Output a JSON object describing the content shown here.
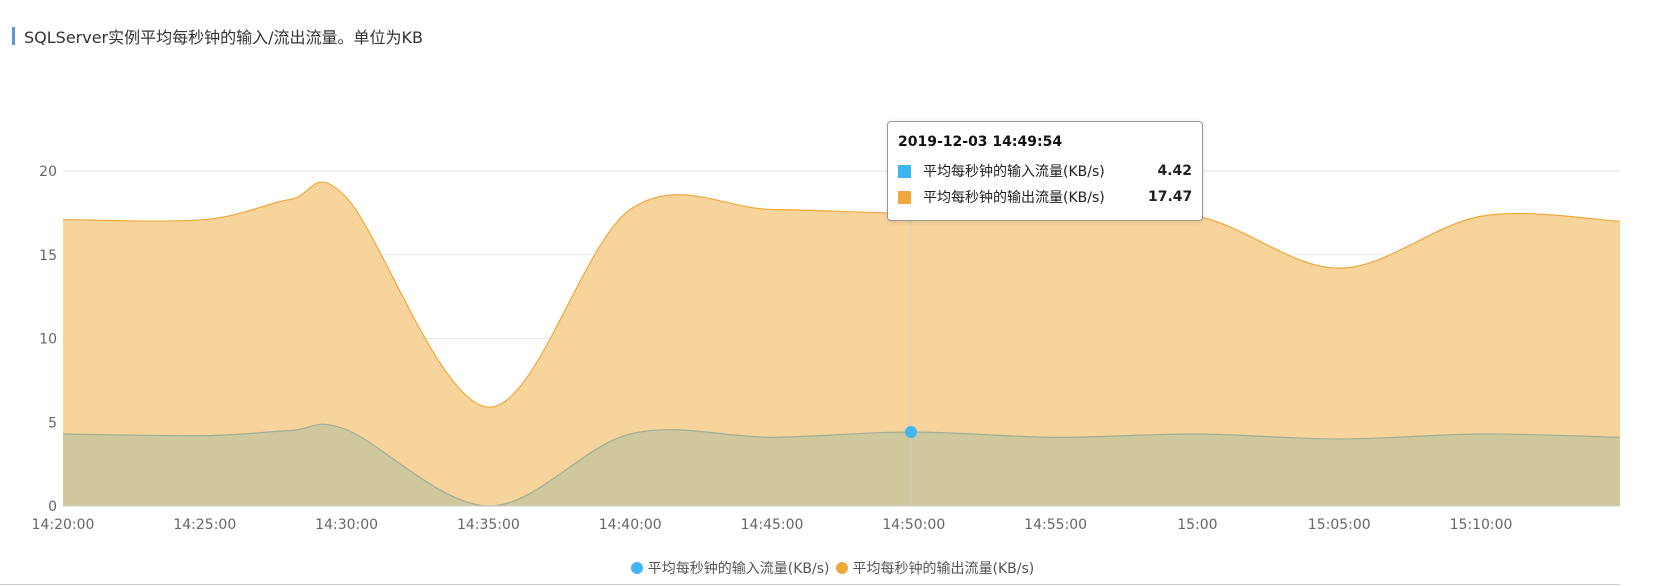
{
  "header": {
    "title": "SQLServer实例平均每秒钟的输入/流出流量。单位为KB"
  },
  "chart_data": {
    "type": "area",
    "title": "SQLServer实例平均每秒钟的输入/流出流量。单位为KB",
    "xlabel": "",
    "ylabel": "",
    "ylim": [
      0,
      20
    ],
    "yticks": [
      "0",
      "5",
      "10",
      "15",
      "20"
    ],
    "xlim": [
      "14:20:00",
      "15:14:54"
    ],
    "xticks": [
      "14:20:00",
      "14:25:00",
      "14:30:00",
      "14:35:00",
      "14:40:00",
      "14:45:00",
      "14:50:00",
      "14:55:00",
      "15:00",
      "15:05:00",
      "15:10:00"
    ],
    "grid": true,
    "legend_position": "bottom",
    "x": [
      "14:20:00",
      "14:25:00",
      "14:28:00",
      "14:30:00",
      "14:35:00",
      "14:40:00",
      "14:45:00",
      "14:49:54",
      "14:55:00",
      "15:00",
      "15:05:00",
      "15:10:00",
      "15:14:54"
    ],
    "series": [
      {
        "name": "平均每秒钟的输入流量(KB/s)",
        "color": "#3fb6f4",
        "fill": "#c8c69e",
        "values": [
          4.3,
          4.2,
          4.5,
          4.55,
          0.0,
          4.3,
          4.1,
          4.42,
          4.1,
          4.3,
          4.0,
          4.3,
          4.1
        ]
      },
      {
        "name": "平均每秒钟的输出流量(KB/s)",
        "color": "#f0a83c",
        "fill": "#f7d49b",
        "values": [
          17.1,
          17.1,
          18.3,
          18.4,
          5.9,
          17.7,
          17.7,
          17.47,
          17.5,
          17.3,
          14.2,
          17.3,
          17.0
        ]
      }
    ],
    "tooltip": {
      "time": "2019-12-03 14:49:54",
      "rows": [
        {
          "name": "平均每秒钟的输入流量(KB/s)",
          "value": "4.42",
          "color": "#3fb6f4"
        },
        {
          "name": "平均每秒钟的输出流量(KB/s)",
          "value": "17.47",
          "color": "#f0a83c"
        }
      ]
    }
  }
}
